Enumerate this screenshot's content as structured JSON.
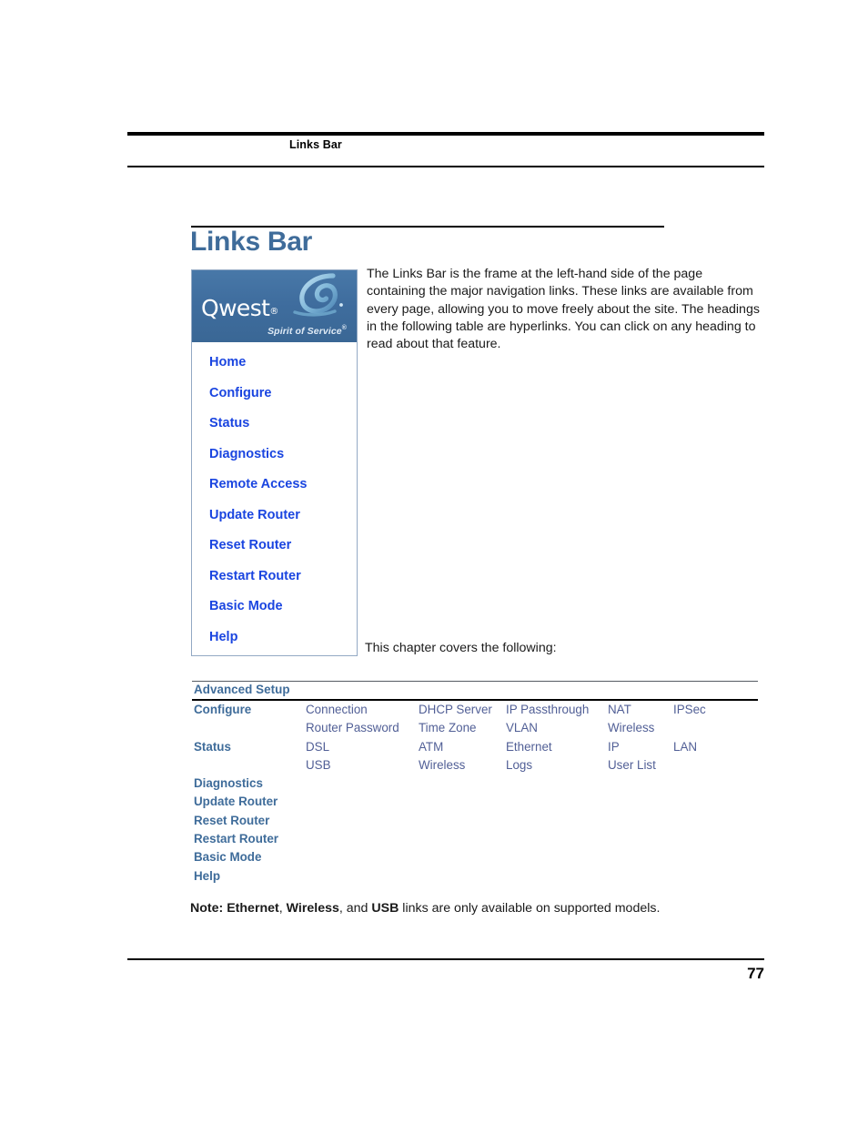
{
  "header": {
    "running_title": "Links Bar"
  },
  "chapter": {
    "title": "Links Bar",
    "intro": "The Links Bar is the frame at the left-hand side of the page containing the major navigation links. These links are available from every page, allowing you to move freely about the site. The headings in the following table are hyperlinks. You can click on any heading to read about that feature.",
    "covers_line": "This chapter covers the following:"
  },
  "linksbar": {
    "logo": {
      "wordmark": "Qwest",
      "registered_mark": "®",
      "tagline": "Spirit of Service",
      "tagline_mark": "®",
      "background_color": "#3f6d9e",
      "swoosh_color": "#8fc3e0"
    },
    "link_color": "#1a45e0",
    "items": [
      {
        "label": "Home"
      },
      {
        "label": "Configure"
      },
      {
        "label": "Status"
      },
      {
        "label": "Diagnostics"
      },
      {
        "label": "Remote Access"
      },
      {
        "label": "Update Router"
      },
      {
        "label": "Reset Router"
      },
      {
        "label": "Restart Router"
      },
      {
        "label": "Basic Mode"
      },
      {
        "label": "Help"
      }
    ]
  },
  "table": {
    "section_title": "Advanced Setup",
    "heading_color": "#3f6c9a",
    "link_color": "#515f96",
    "rows": [
      {
        "heading": "Configure",
        "links": [
          "Connection",
          "DHCP Server",
          "IP Passthrough",
          "NAT",
          "IPSec"
        ]
      },
      {
        "heading": "",
        "links": [
          "Router Password",
          "Time Zone",
          "VLAN",
          "Wireless"
        ]
      },
      {
        "heading": "Status",
        "links": [
          "DSL",
          "ATM",
          "Ethernet",
          "IP",
          "LAN"
        ]
      },
      {
        "heading": "",
        "links": [
          "USB",
          "Wireless",
          "Logs",
          "User List"
        ]
      },
      {
        "heading": "Diagnostics",
        "links": []
      },
      {
        "heading": "Update Router",
        "links": []
      },
      {
        "heading": "Reset Router",
        "links": []
      },
      {
        "heading": "Restart Router",
        "links": []
      },
      {
        "heading": "Basic Mode",
        "links": []
      },
      {
        "heading": "Help",
        "links": []
      }
    ]
  },
  "note": {
    "prefix": "Note: ",
    "term1": "Ethernet",
    "sep1": ", ",
    "term2": "Wireless",
    "sep2": ", and ",
    "term3": "USB",
    "suffix": " links are only available on supported models."
  },
  "footer": {
    "page_number": "77"
  }
}
